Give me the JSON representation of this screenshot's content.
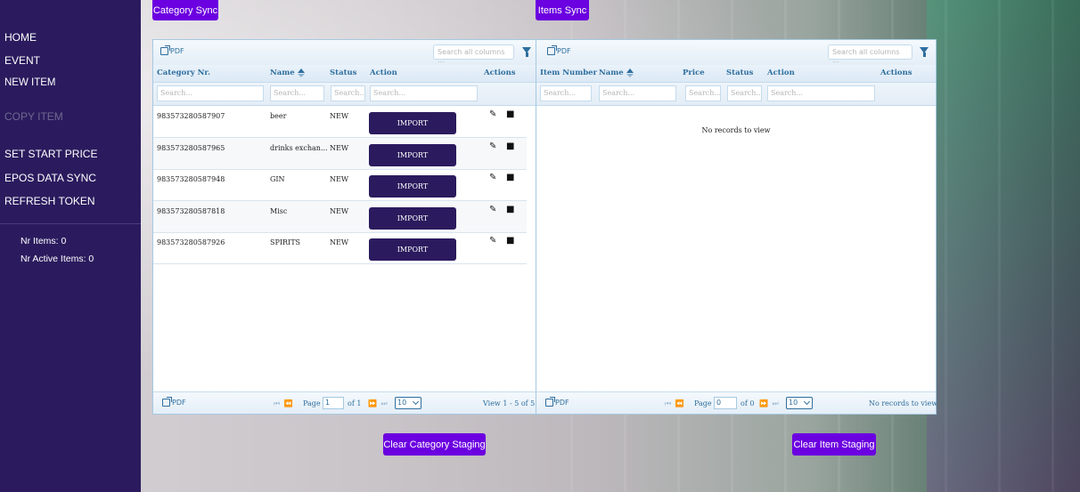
{
  "sidebar": {
    "nav": [
      "HOME",
      "EVENT",
      "NEW ITEM",
      "COPY ITEM",
      "SET START PRICE",
      "EPOS DATA SYNC",
      "REFRESH TOKEN"
    ],
    "stats": {
      "nr_items": "Nr Items: 0",
      "nr_active_items": "Nr Active Items: 0"
    }
  },
  "category_sync_label": "Category Sync",
  "items_sync_label": "Items Sync",
  "category_grid": {
    "pdf_label": "PDF",
    "search_placeholder": "Search all columns ...",
    "columns": [
      "Category Nr.",
      "Name",
      "Status",
      "Action",
      "Actions"
    ],
    "filter_placeholders": [
      "Search...",
      "Search...",
      "Search...",
      "Search..."
    ],
    "import_label": "IMPORT",
    "rows": [
      [
        "983573280587907",
        "beer",
        "NEW"
      ],
      [
        "983573280587965",
        "drinks exchan...",
        "NEW"
      ],
      [
        "983573280587948",
        "GIN",
        "NEW"
      ],
      [
        "983573280587818",
        "Misc",
        "NEW"
      ],
      [
        "983573280587926",
        "SPIRITS",
        "NEW"
      ]
    ],
    "pager": {
      "page_label": "Page",
      "page_value": "1",
      "of_label": "of 1",
      "page_size": "10",
      "view_text": "View 1 - 5 of 5"
    }
  },
  "items_grid": {
    "pdf_label": "PDF",
    "search_placeholder": "Search all columns ...",
    "columns": [
      "Item Number",
      "Name",
      "Price",
      "Status",
      "Action",
      "Actions"
    ],
    "filter_placeholders": [
      "Search...",
      "Search...",
      "Search...",
      "Search...",
      "Search..."
    ],
    "empty_text": "No records to view",
    "pager": {
      "page_label": "Page",
      "page_value": "0",
      "of_label": "of 0",
      "page_size": "10",
      "view_text": "No records to view"
    }
  },
  "clear_category_label": "Clear Category Staging",
  "clear_item_label": "Clear Item Staging",
  "icons": {
    "edit": "pencil-icon",
    "delete": "trash-icon",
    "filter": "filter-icon",
    "pdf": "external-link-icon",
    "sort": "sort-icon"
  }
}
